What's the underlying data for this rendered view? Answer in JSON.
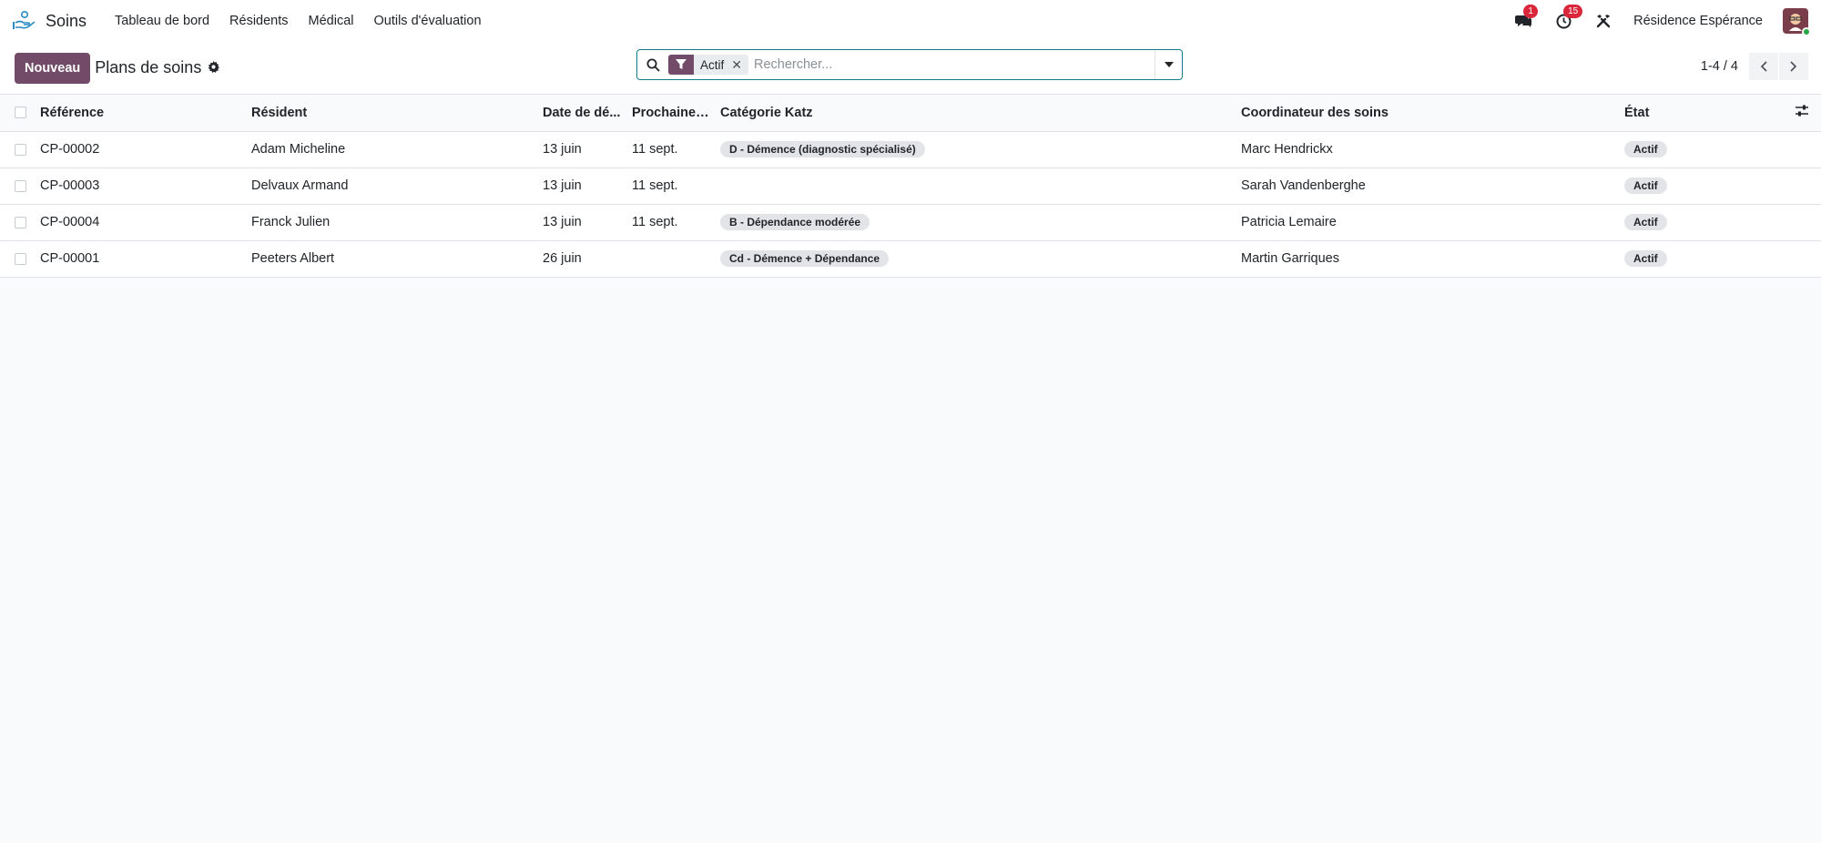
{
  "navbar": {
    "app_name": "Soins",
    "menu": [
      "Tableau de bord",
      "Résidents",
      "Médical",
      "Outils d'évaluation"
    ],
    "messages_count": "1",
    "activities_count": "15",
    "company": "Résidence Espérance"
  },
  "control_panel": {
    "new_button": "Nouveau",
    "title": "Plans de soins",
    "search": {
      "facet_label": "Actif",
      "placeholder": "Rechercher..."
    },
    "pager": "1-4 / 4"
  },
  "table": {
    "columns": [
      "Référence",
      "Résident",
      "Date de dé...",
      "Prochaine r...",
      "Catégorie Katz",
      "Coordinateur des soins",
      "État"
    ],
    "rows": [
      {
        "ref": "CP-00002",
        "resident": "Adam Micheline",
        "date_debut": "13 juin",
        "prochaine": "11 sept.",
        "katz": "D - Démence (diagnostic spécialisé)",
        "coordinateur": "Marc Hendrickx",
        "etat": "Actif"
      },
      {
        "ref": "CP-00003",
        "resident": "Delvaux Armand",
        "date_debut": "13 juin",
        "prochaine": "11 sept.",
        "katz": "",
        "coordinateur": "Sarah Vandenberghe",
        "etat": "Actif"
      },
      {
        "ref": "CP-00004",
        "resident": "Franck Julien",
        "date_debut": "13 juin",
        "prochaine": "11 sept.",
        "katz": "B - Dépendance modérée",
        "coordinateur": "Patricia Lemaire",
        "etat": "Actif"
      },
      {
        "ref": "CP-00001",
        "resident": "Peeters Albert",
        "date_debut": "26 juin",
        "prochaine": "",
        "katz": "Cd - Démence + Dépendance",
        "coordinateur": "Martin Garriques",
        "etat": "Actif"
      }
    ]
  },
  "colors": {
    "primary": "#714b67",
    "search_border": "#0e7c86",
    "badge": "#d9263b",
    "online": "#28a745"
  }
}
